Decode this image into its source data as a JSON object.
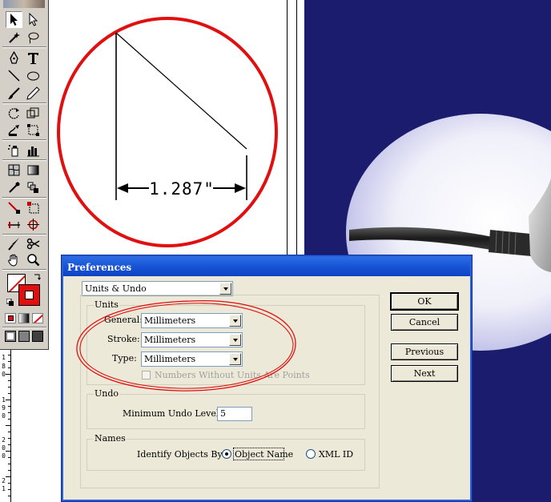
{
  "drawing": {
    "dimension_label": "1.287\""
  },
  "ruler": {
    "labels": [
      "1",
      "8",
      "0",
      "1",
      "9",
      "0",
      "2",
      "0",
      "0",
      "2",
      "1"
    ]
  },
  "toolbox": {
    "tools": [
      "selection",
      "direct-selection",
      "magic-wand",
      "lasso",
      "pen",
      "type",
      "line-segment",
      "ellipse",
      "paintbrush",
      "pencil",
      "rotate",
      "scale",
      "warp",
      "free-transform",
      "symbol-sprayer",
      "column-graph",
      "mesh",
      "gradient",
      "eyedropper",
      "blend",
      "slice",
      "slice-select",
      "scissors",
      "knife",
      "hand",
      "zoom"
    ],
    "fill_color": "#ffffff",
    "stroke_color": "#e01010"
  },
  "dialog": {
    "title": "Preferences",
    "category": "Units & Undo",
    "units_group": {
      "title": "Units",
      "general_label": "General:",
      "general_value": "Millimeters",
      "stroke_label": "Stroke:",
      "stroke_value": "Millimeters",
      "type_label": "Type:",
      "type_value": "Millimeters",
      "numbers_checkbox_label": "Numbers Without Units Are Points",
      "numbers_checked": false
    },
    "undo_group": {
      "title": "Undo",
      "min_undo_label": "Minimum Undo Levels:",
      "min_undo_value": "5"
    },
    "names_group": {
      "title": "Names",
      "identify_label": "Identify Objects By:",
      "object_name_label": "Object Name",
      "xml_id_label": "XML ID",
      "selected": "Object Name"
    },
    "buttons": {
      "ok": "OK",
      "cancel": "Cancel",
      "previous": "Previous",
      "next": "Next"
    }
  },
  "colors": {
    "annotation_red": "#e01010",
    "title_bar_blue": "#1956d6",
    "navy_background": "#1c1c6e",
    "dialog_face": "#ece9d8"
  }
}
